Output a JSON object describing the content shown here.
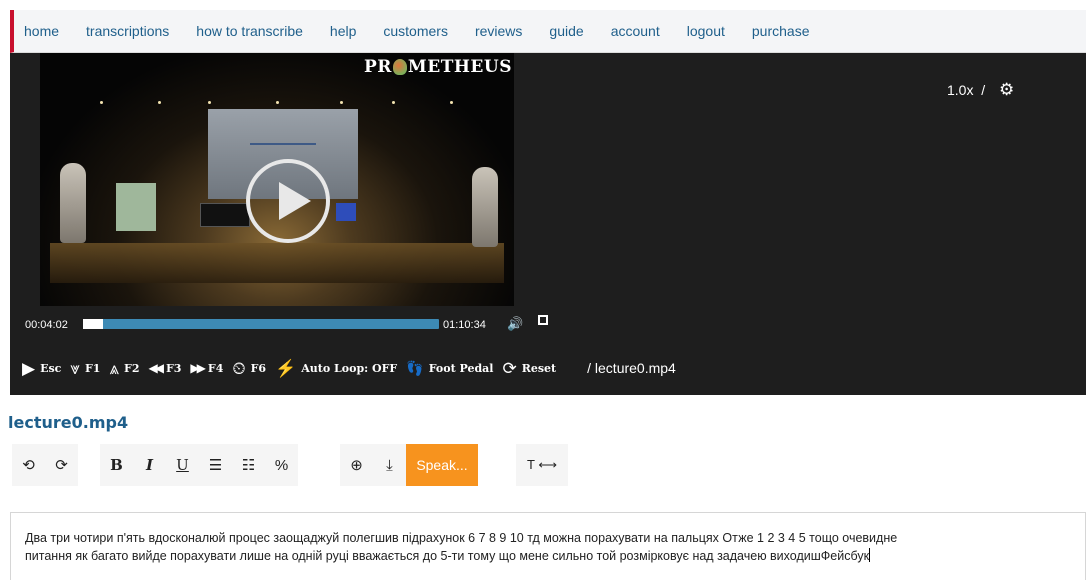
{
  "nav": {
    "items": [
      "home",
      "transcriptions",
      "how to transcribe",
      "help",
      "customers",
      "reviews",
      "guide",
      "account",
      "logout",
      "purchase"
    ]
  },
  "player": {
    "logo_text_1": "PR",
    "logo_text_2": "METHEUS",
    "playback_rate": "1.0x",
    "rate_separator": "/",
    "current_time": "00:04:02",
    "total_time": "01:10:34",
    "progress_fraction": 0.057,
    "filepath": "/ lecture0.mp4",
    "controls": [
      {
        "icon": "play-icon",
        "glyph": "▶",
        "label": "Esc"
      },
      {
        "icon": "rewind-chevrons-icon",
        "glyph": "⩔",
        "label": "F1"
      },
      {
        "icon": "forward-chevrons-icon",
        "glyph": "⩓",
        "label": "F2"
      },
      {
        "icon": "back-icon",
        "glyph": "◀◀",
        "label": "F3"
      },
      {
        "icon": "fast-forward-icon",
        "glyph": "▶▶",
        "label": "F4"
      },
      {
        "icon": "timer-icon",
        "glyph": "⏲",
        "label": "F6"
      },
      {
        "icon": "lightning-icon",
        "glyph": "⚡",
        "label": "Auto Loop: OFF"
      },
      {
        "icon": "foot-icon",
        "glyph": "👣",
        "label": "Foot Pedal"
      },
      {
        "icon": "reset-icon",
        "glyph": "⟳",
        "label": "Reset"
      }
    ]
  },
  "editor": {
    "file_title": "lecture0.mp4",
    "speak_label": "Speak...",
    "text_width_label": "T ⟷",
    "content_line_1": "Два три чотири п'ять вдосконалюй процес заощаджуй полегшив підрахунок 6 7 8 9 10 тд можна порахувати на пальцях Отже 1 2 3 4 5 тощо очевидне",
    "content_line_2": "питання як багато вийде порахувати лише на одній руці вважається до 5-ти тому що мене сильно той розмірковує над задачею виходишФейсбук"
  },
  "colors": {
    "nav_link": "#1f5f8b",
    "nav_accent": "#c8102e",
    "player_bg": "#1e1e1e",
    "progress": "#3d8ab5",
    "speak_button": "#f7931e"
  }
}
